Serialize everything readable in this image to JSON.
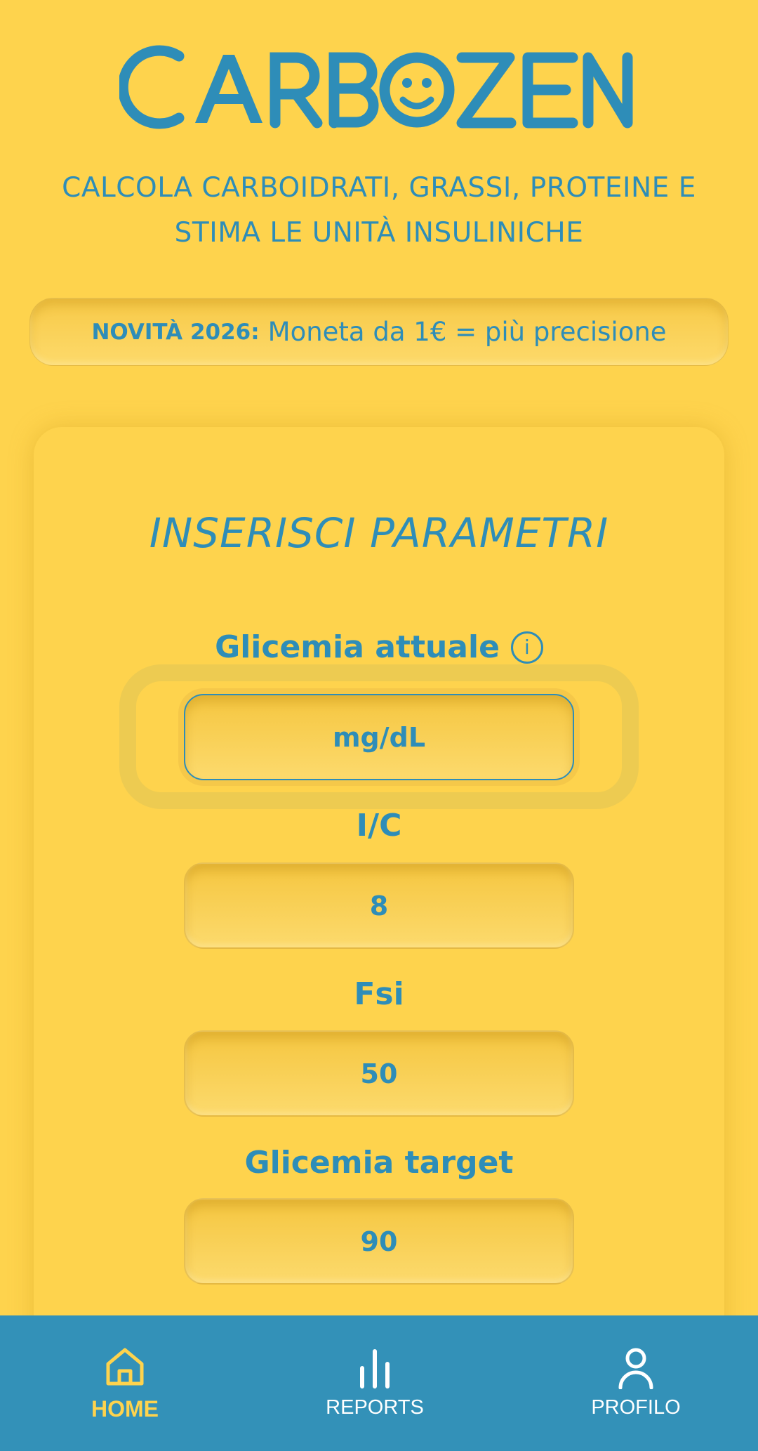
{
  "app": {
    "logo_text": "CARBOZEN",
    "subtitle": "CALCOLA CARBOIDRATI, GRASSI, PROTEINE E STIMA LE UNITÀ INSULINICHE"
  },
  "news": {
    "label": "NOVITÀ 2026:",
    "text": "Moneta da 1€ = più precisione"
  },
  "form": {
    "title": "INSERISCI PARAMETRI",
    "fields": [
      {
        "label": "Glicemia attuale",
        "value": "",
        "placeholder": "mg/dL",
        "has_info": true
      },
      {
        "label": "I/C",
        "value": "8",
        "placeholder": ""
      },
      {
        "label": "Fsi",
        "value": "50",
        "placeholder": ""
      },
      {
        "label": "Glicemia target",
        "value": "90",
        "placeholder": ""
      }
    ],
    "info_symbol": "i"
  },
  "nav": {
    "items": [
      {
        "label": "HOME",
        "icon": "home-icon",
        "active": true
      },
      {
        "label": "REPORTS",
        "icon": "bar-chart-icon",
        "active": false
      },
      {
        "label": "PROFILO",
        "icon": "user-icon",
        "active": false
      }
    ]
  },
  "colors": {
    "background": "#FED34D",
    "primary": "#2E8DB8",
    "nav_bg": "#3391B8",
    "nav_active": "#FED34D"
  }
}
